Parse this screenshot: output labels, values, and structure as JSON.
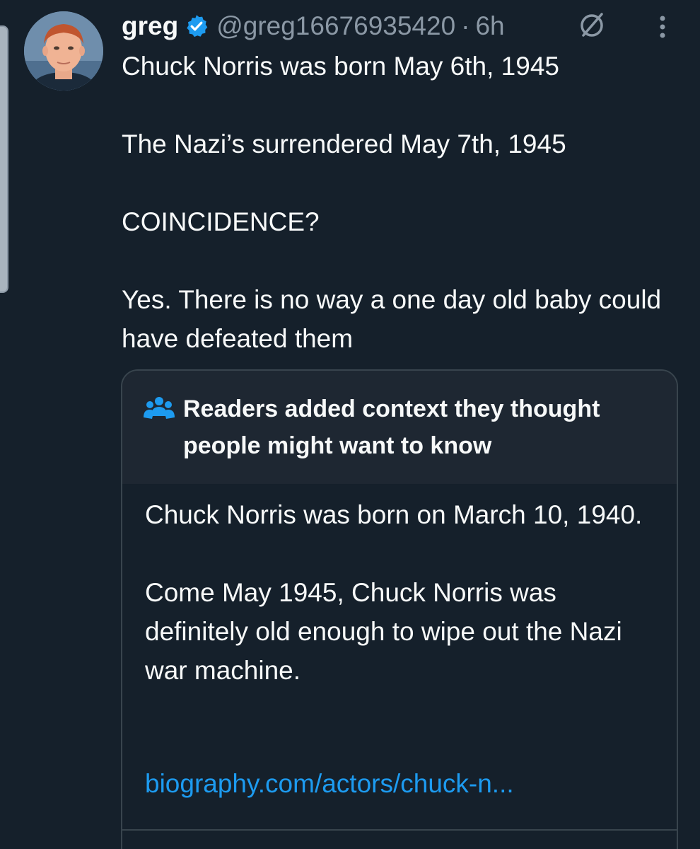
{
  "tweet": {
    "display_name": "greg",
    "handle": "@greg16676935420",
    "separator": "·",
    "time": "6h",
    "body": [
      "Chuck Norris was born May 6th, 1945",
      "",
      "The Nazi’s surrendered May 7th, 1945",
      "",
      "COINCIDENCE?",
      "",
      "Yes. There is no way a one day old baby could have defeated them"
    ]
  },
  "community_note": {
    "title": "Readers added context they thought people might want to know",
    "body": [
      "Chuck Norris was born on March 10, 1940.",
      "",
      "Come May 1945, Chuck Norris was definitely old enough to wipe out the Nazi war machine."
    ],
    "link": "biography.com/actors/chuck-n..."
  },
  "icons": {
    "verified": "verified-badge-icon",
    "grok": "grok-icon",
    "more": "more-options-icon",
    "note": "community-notes-people-icon"
  },
  "colors": {
    "background": "#15202b",
    "text": "#f7f9f9",
    "secondary": "#8b98a5",
    "accent": "#1d9bf0",
    "border": "#38444d",
    "note_header_bg": "#1e2732"
  }
}
